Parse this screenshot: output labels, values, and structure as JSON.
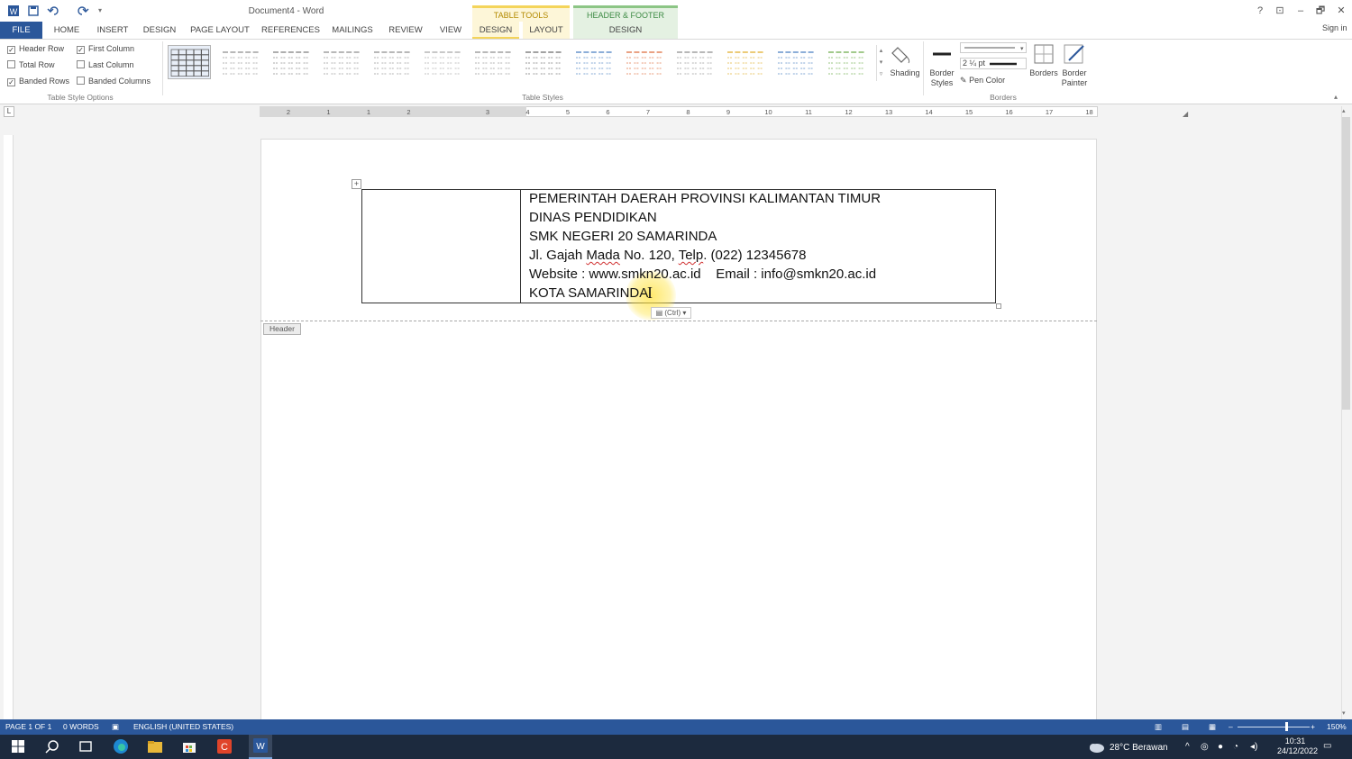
{
  "window": {
    "title": "Document4 - Word",
    "signin": "Sign in",
    "help": "?",
    "ribbon_display": "⊡",
    "minimize": "–",
    "restore": "🗗",
    "close": "✕"
  },
  "context_tabs": {
    "table_tools": "TABLE TOOLS",
    "header_footer_tools": "HEADER & FOOTER TOOLS"
  },
  "tabs": {
    "file": "FILE",
    "home": "HOME",
    "insert": "INSERT",
    "design": "DESIGN",
    "page_layout": "PAGE LAYOUT",
    "references": "REFERENCES",
    "mailings": "MAILINGS",
    "review": "REVIEW",
    "view": "VIEW",
    "table_design": "DESIGN",
    "table_layout": "LAYOUT",
    "hf_design": "DESIGN"
  },
  "table_style_options": {
    "header_row": "Header Row",
    "first_column": "First Column",
    "total_row": "Total Row",
    "last_column": "Last Column",
    "banded_rows": "Banded Rows",
    "banded_columns": "Banded Columns",
    "group_label": "Table Style Options"
  },
  "table_styles": {
    "group_label": "Table Styles",
    "thumb_colors": [
      "#555555",
      "#9a9a9a",
      "#8c8c8c",
      "#9a9a9a",
      "#9a9a9a",
      "#b0b0b0",
      "#9a9a9a",
      "#7a7a7a",
      "#5b8cc7",
      "#e27b4f",
      "#9a9a9a",
      "#e3b53e",
      "#5b8cc7",
      "#7ab35a"
    ]
  },
  "borders": {
    "shading": "Shading",
    "border_styles_1": "Border",
    "border_styles_2": "Styles",
    "weight": "2 ¼ pt",
    "pen_color": "Pen Color",
    "borders_btn": "Borders",
    "border_painter_1": "Border",
    "border_painter_2": "Painter",
    "group_label": "Borders"
  },
  "ruler": {
    "left_marks": [
      "2",
      "1",
      "1",
      "2"
    ],
    "marks": [
      "3",
      "4",
      "5",
      "6",
      "7",
      "8",
      "9",
      "10",
      "11",
      "12",
      "13",
      "14",
      "15",
      "16",
      "17",
      "18"
    ]
  },
  "header_tag": "Header",
  "letterhead": {
    "line1": "PEMERINTAH DAERAH PROVINSI KALIMANTAN TIMUR",
    "line2": "DINAS PENDIDIKAN",
    "line3": "SMK NEGERI 20 SAMARINDA",
    "line4_a": "Jl. Gajah ",
    "line4_b": "Mada",
    "line4_c": " No. 120, ",
    "line4_d": "Telp",
    "line4_e": ". (022) 12345678",
    "line5": "Website : www.smkn20.ac.id    Email : info@smkn20.ac.id",
    "line6": "KOTA SAMARINDA"
  },
  "paste_options": "(Ctrl)",
  "status": {
    "page": "PAGE 1 OF 1",
    "words": "0 WORDS",
    "language": "ENGLISH (UNITED STATES)",
    "zoom": "150%",
    "zoom_level": 0.66
  },
  "taskbar": {
    "weather": "28°C  Berawan",
    "time": "10:31",
    "date": "24/12/2022"
  },
  "colors": {
    "word_blue": "#2b579a",
    "table_tools": "#f4d45a",
    "header_footer_tools": "#8cc585"
  }
}
